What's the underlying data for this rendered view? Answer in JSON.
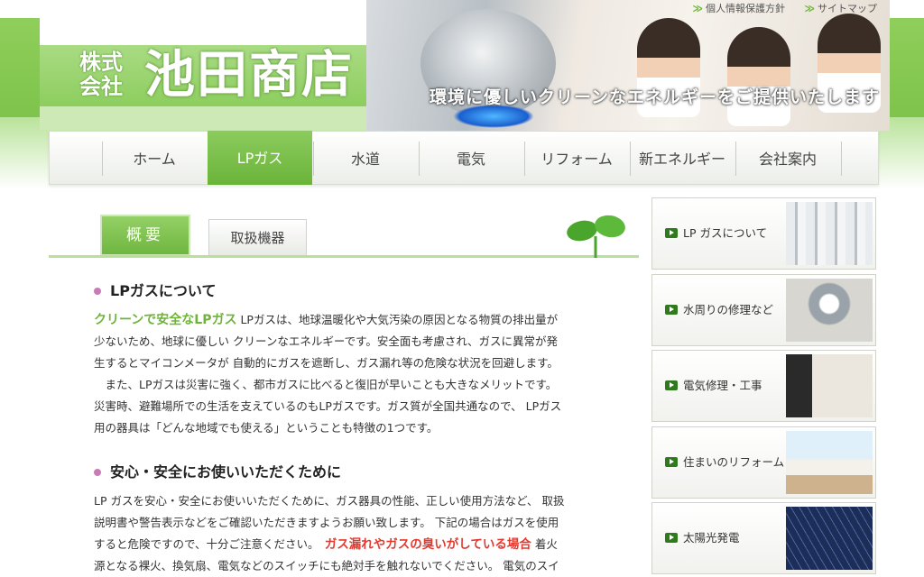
{
  "header": {
    "logo_small": "株式会社",
    "logo_main": "池田商店",
    "tagline": "環境に優しいクリーンなエネルギーをご提供いたします",
    "links": [
      {
        "label": "個人情報保護方針"
      },
      {
        "label": "サイトマップ"
      }
    ]
  },
  "nav": {
    "items": [
      {
        "label": "ホーム"
      },
      {
        "label": "LPガス"
      },
      {
        "label": "水道"
      },
      {
        "label": "電気"
      },
      {
        "label": "リフォーム"
      },
      {
        "label": "新エネルギー"
      },
      {
        "label": "会社案内"
      }
    ],
    "active_index": 1
  },
  "tabs": {
    "active": "概要",
    "inactive": "取扱機器"
  },
  "content": {
    "section1": {
      "heading": "LPガスについて",
      "lead": "クリーンで安全なLPガス",
      "lines": [
        "LPガスは、地球温暖化や大気汚染の原因となる物質の排出量が",
        "少ないため、地球に優しい クリーンなエネルギーです。安全面も考慮され、ガスに異常が発",
        "生するとマイコンメータが 自動的にガスを遮断し、ガス漏れ等の危険な状況を回避します。",
        "　また、LPガスは災害に強く、都市ガスに比べると復旧が早いことも大きなメリットです。",
        "災害時、避難場所での生活を支えているのもLPガスです。ガス質が全国共通なので、 LPガス",
        "用の器具は「どんな地域でも使える」ということも特徴の1つです。"
      ]
    },
    "section2": {
      "heading": "安心・安全にお使いいただくために",
      "lines": [
        "LP ガスを安心・安全にお使いいただくために、ガス器具の性能、正しい使用方法など、 取扱",
        "説明書や警告表示などをご確認いただきますようお願い致します。 下記の場合はガスを使用",
        "すると危険ですので、十分ご注意ください。"
      ],
      "warning": "ガス漏れやガスの臭いがしている場合",
      "after_warning": " 着火",
      "last_line": "源となる裸火、換気扇、電気などのスイッチにも絶対手を触れないでください。 電気のスイ"
    }
  },
  "sidebar": {
    "items": [
      {
        "label": "LP ガスについて",
        "thumb": "gas-cylinders"
      },
      {
        "label": "水周りの修理など",
        "thumb": "faucet"
      },
      {
        "label": "電気修理・工事",
        "thumb": "switch-panel"
      },
      {
        "label": "住まいのリフォーム",
        "thumb": "kitchen"
      },
      {
        "label": "太陽光発電",
        "thumb": "solar-panels"
      }
    ]
  },
  "colors": {
    "brand_green": "#7cc24a",
    "accent_red": "#e5392f",
    "bullet_pink": "#c87bb6"
  }
}
